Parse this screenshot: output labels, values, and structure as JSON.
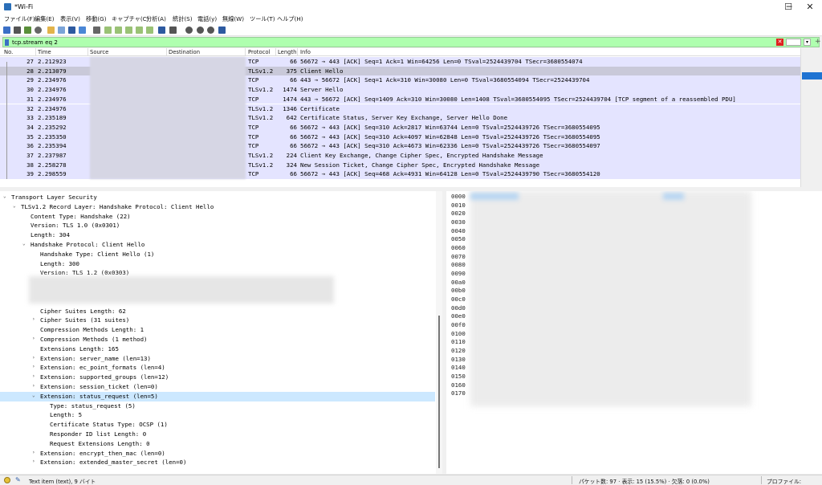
{
  "window": {
    "title": "*Wi-Fi",
    "minimize": "─",
    "maximize": "☐",
    "close": "✕"
  },
  "menu": [
    "ファイル(F)",
    "編集(E)",
    "表示(V)",
    "移動(G)",
    "キャプチャ(C)",
    "分析(A)",
    "統計(S)",
    "電話(y)",
    "無線(W)",
    "ツール(T)",
    "ヘルプ(H)"
  ],
  "filter": {
    "value": "tcp.stream eq 2",
    "clear_icon": "✕",
    "dropdown_icon": "▾",
    "add_icon": "+"
  },
  "columns": [
    "No.",
    "Time",
    "Source",
    "Destination",
    "Protocol",
    "Length",
    "Info"
  ],
  "packets": [
    {
      "no": "27",
      "time": "2.212923",
      "protocol": "TCP",
      "length": "66",
      "info": "56672 → 443 [ACK] Seq=1 Ack=1 Win=64256 Len=0 TSval=2524439704 TSecr=3680554074"
    },
    {
      "no": "28",
      "time": "2.213079",
      "protocol": "TLSv1.2",
      "length": "375",
      "info": "Client Hello"
    },
    {
      "no": "29",
      "time": "2.234976",
      "protocol": "TCP",
      "length": "66",
      "info": "443 → 56672 [ACK] Seq=1 Ack=310 Win=30080 Len=0 TSval=3680554094 TSecr=2524439704"
    },
    {
      "no": "30",
      "time": "2.234976",
      "protocol": "TLSv1.2",
      "length": "1474",
      "info": "Server Hello"
    },
    {
      "no": "31",
      "time": "2.234976",
      "protocol": "TCP",
      "length": "1474",
      "info": "443 → 56672 [ACK] Seq=1409 Ack=310 Win=30080 Len=1408 TSval=3680554095 TSecr=2524439704 [TCP segment of a reassembled PDU]"
    },
    {
      "no": "32",
      "time": "2.234976",
      "protocol": "TLSv1.2",
      "length": "1346",
      "info": "Certificate"
    },
    {
      "no": "33",
      "time": "2.235189",
      "protocol": "TLSv1.2",
      "length": "642",
      "info": "Certificate Status, Server Key Exchange, Server Hello Done"
    },
    {
      "no": "34",
      "time": "2.235292",
      "protocol": "TCP",
      "length": "66",
      "info": "56672 → 443 [ACK] Seq=310 Ack=2817 Win=63744 Len=0 TSval=2524439726 TSecr=3680554095"
    },
    {
      "no": "35",
      "time": "2.235350",
      "protocol": "TCP",
      "length": "66",
      "info": "56672 → 443 [ACK] Seq=310 Ack=4097 Win=62848 Len=0 TSval=2524439726 TSecr=3680554095"
    },
    {
      "no": "36",
      "time": "2.235394",
      "protocol": "TCP",
      "length": "66",
      "info": "56672 → 443 [ACK] Seq=310 Ack=4673 Win=62336 Len=0 TSval=2524439726 TSecr=3680554097"
    },
    {
      "no": "37",
      "time": "2.237987",
      "protocol": "TLSv1.2",
      "length": "224",
      "info": "Client Key Exchange, Change Cipher Spec, Encrypted Handshake Message"
    },
    {
      "no": "38",
      "time": "2.258278",
      "protocol": "TLSv1.2",
      "length": "324",
      "info": "New Session Ticket, Change Cipher Spec, Encrypted Handshake Message"
    },
    {
      "no": "39",
      "time": "2.298559",
      "protocol": "TCP",
      "length": "66",
      "info": "56672 → 443 [ACK] Seq=468 Ack=4931 Win=64128 Len=0 TSval=2524439790 TSecr=3680554120"
    }
  ],
  "selected_packet": "28",
  "details": [
    {
      "text": "Transport Layer Security",
      "arrow": "⌄",
      "level": 0
    },
    {
      "text": "TLSv1.2 Record Layer: Handshake Protocol: Client Hello",
      "arrow": "⌄",
      "level": 1
    },
    {
      "text": "Content Type: Handshake (22)",
      "arrow": "",
      "level": 2
    },
    {
      "text": "Version: TLS 1.0 (0x0301)",
      "arrow": "",
      "level": 2
    },
    {
      "text": "Length: 304",
      "arrow": "",
      "level": 2
    },
    {
      "text": "Handshake Protocol: Client Hello",
      "arrow": "⌄",
      "level": 2
    },
    {
      "text": "Handshake Type: Client Hello (1)",
      "arrow": "",
      "level": 3
    },
    {
      "text": "Length: 300",
      "arrow": "",
      "level": 3
    },
    {
      "text": "Version: TLS 1.2 (0x0303)",
      "arrow": "",
      "level": 3
    },
    {
      "text": "",
      "arrow": "",
      "level": 3
    },
    {
      "text": "",
      "arrow": "",
      "level": 3
    },
    {
      "text": "",
      "arrow": "",
      "level": 3
    },
    {
      "text": "Cipher Suites Length: 62",
      "arrow": "",
      "level": 3
    },
    {
      "text": "Cipher Suites (31 suites)",
      "arrow": "›",
      "level": 3
    },
    {
      "text": "Compression Methods Length: 1",
      "arrow": "",
      "level": 3
    },
    {
      "text": "Compression Methods (1 method)",
      "arrow": "›",
      "level": 3
    },
    {
      "text": "Extensions Length: 165",
      "arrow": "",
      "level": 3
    },
    {
      "text": "Extension: server_name (len=13)",
      "arrow": "›",
      "level": 3
    },
    {
      "text": "Extension: ec_point_formats (len=4)",
      "arrow": "›",
      "level": 3
    },
    {
      "text": "Extension: supported_groups (len=12)",
      "arrow": "›",
      "level": 3
    },
    {
      "text": "Extension: session_ticket (len=0)",
      "arrow": "›",
      "level": 3
    },
    {
      "text": "Extension: status_request (len=5)",
      "arrow": "⌄",
      "level": 3,
      "selected": true
    },
    {
      "text": "Type: status_request (5)",
      "arrow": "",
      "level": 4
    },
    {
      "text": "Length: 5",
      "arrow": "",
      "level": 4
    },
    {
      "text": "Certificate Status Type: OCSP (1)",
      "arrow": "",
      "level": 4
    },
    {
      "text": "Responder ID list Length: 0",
      "arrow": "",
      "level": 4
    },
    {
      "text": "Request Extensions Length: 0",
      "arrow": "",
      "level": 4
    },
    {
      "text": "Extension: encrypt_then_mac (len=0)",
      "arrow": "›",
      "level": 3
    },
    {
      "text": "Extension: extended_master_secret (len=0)",
      "arrow": "›",
      "level": 3
    }
  ],
  "offsets": [
    "0000",
    "0010",
    "0020",
    "0030",
    "0040",
    "0050",
    "0060",
    "0070",
    "0080",
    "0090",
    "00a0",
    "00b0",
    "00c0",
    "00d0",
    "00e0",
    "00f0",
    "0100",
    "0110",
    "0120",
    "0130",
    "0140",
    "0150",
    "0160",
    "0170"
  ],
  "status": {
    "message": "Text item (text), 9 バイト",
    "packets": "パケット数: 97 · 表示: 15 (15.5%) · 欠落: 0 (0.0%)",
    "profile": "プロファイル: Default"
  },
  "colors": {
    "row_bg": "#e4e4ff",
    "row_selected": "#c9c9d9",
    "filter_ok": "#afffaf",
    "detail_selected": "#cce8ff"
  }
}
